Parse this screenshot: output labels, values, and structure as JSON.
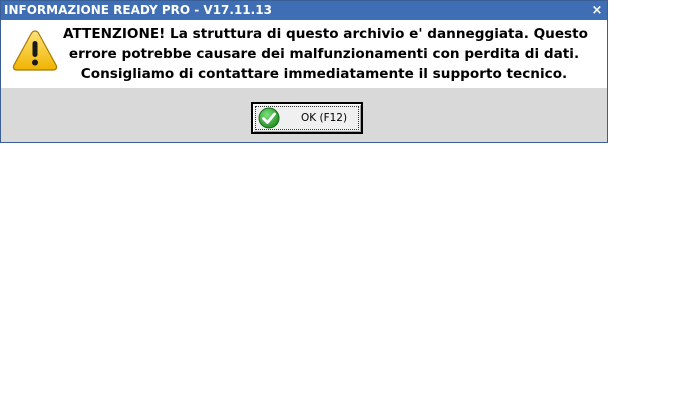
{
  "window": {
    "title": "INFORMAZIONE READY PRO - V17.11.13",
    "close_glyph": "×"
  },
  "message": {
    "line1": "ATTENZIONE! La struttura di questo archivio e' danneggiata. Questo",
    "line2": "errore potrebbe causare dei malfunzionamenti con perdita di dati.",
    "line3": "Consigliamo di contattare immediatamente il supporto tecnico."
  },
  "icons": {
    "warning": "warning-icon",
    "ok": "check-icon"
  },
  "buttons": {
    "ok_label": "OK (F12)"
  },
  "colors": {
    "titlebar": "#3f6eb4",
    "warning_yellow": "#f5c518",
    "ok_green": "#2ea02e"
  }
}
